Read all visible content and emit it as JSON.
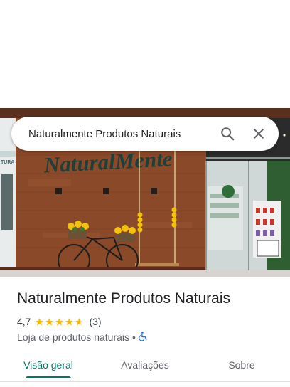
{
  "search": {
    "query": "Naturalmente Produtos Naturais",
    "search_icon": "search-icon",
    "close_icon": "close-icon"
  },
  "photo": {
    "sign_text": "NaturalMente",
    "side_sign_text": "TURA"
  },
  "place": {
    "name": "Naturalmente Produtos Naturais",
    "rating": "4,7",
    "rating_value": 4.7,
    "stars_max": 5,
    "review_count": "(3)",
    "category": "Loja de produtos naturais",
    "separator": "•",
    "accessibility_icon": "wheelchair-icon"
  },
  "tabs": [
    {
      "label": "Visão geral",
      "active": true
    },
    {
      "label": "Avaliações",
      "active": false
    },
    {
      "label": "Sobre",
      "active": false
    }
  ],
  "colors": {
    "accent": "#00796b",
    "star": "#fbbc04",
    "accessibility": "#1a73e8"
  }
}
